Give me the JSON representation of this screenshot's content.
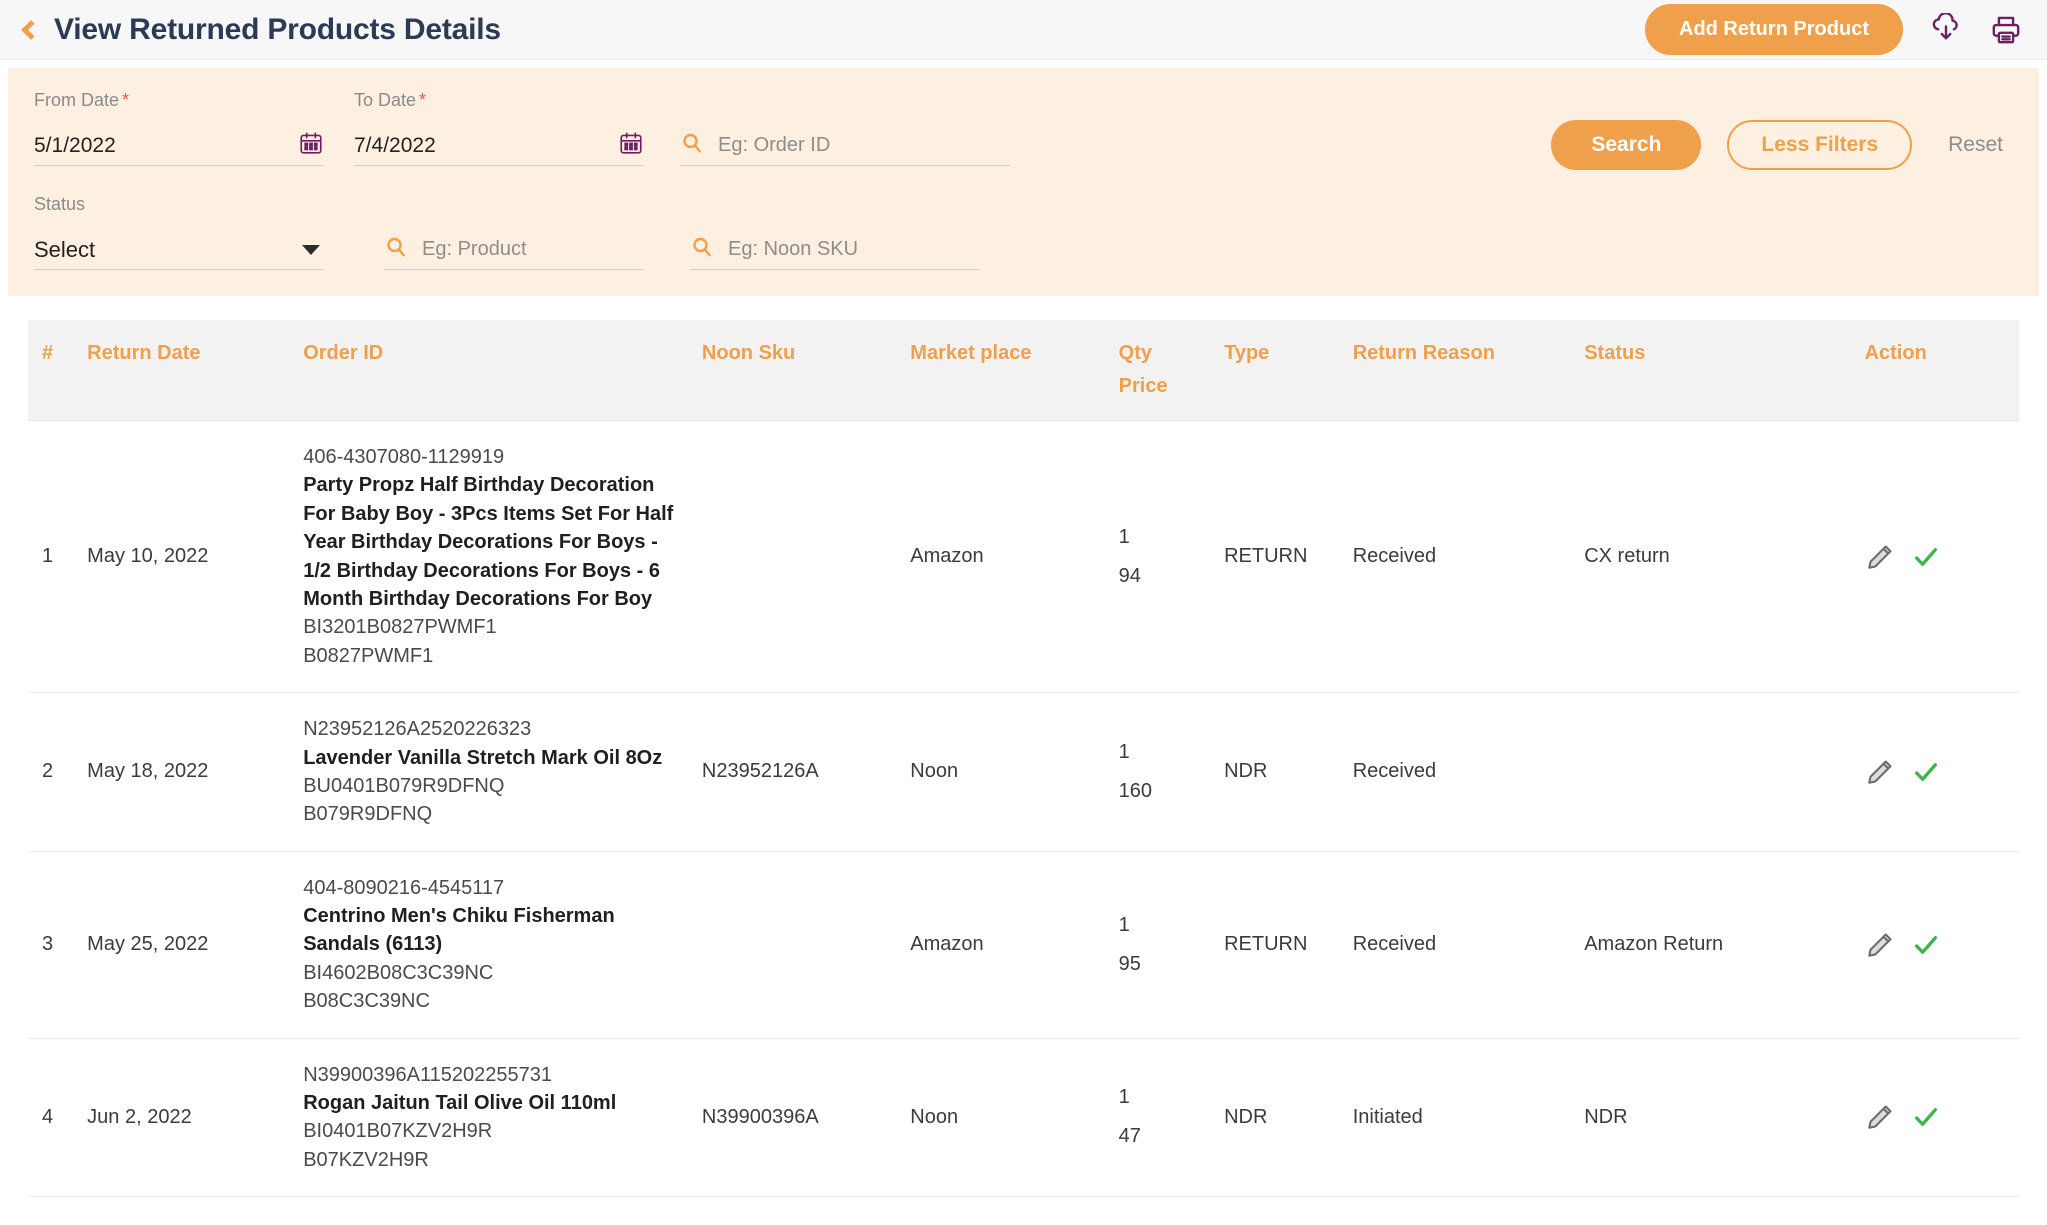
{
  "header": {
    "title": "View Returned Products Details",
    "back_icon": "chevron-left-icon",
    "add_button": "Add Return Product",
    "download_icon": "download-icon",
    "print_icon": "print-icon",
    "accent_color": "#f0a04b",
    "icon_color": "#6d2060"
  },
  "filters": {
    "from_date": {
      "label": "From Date",
      "required": "*",
      "value": "5/1/2022",
      "icon": "calendar-icon"
    },
    "to_date": {
      "label": "To Date",
      "required": "*",
      "value": "7/4/2022",
      "icon": "calendar-icon"
    },
    "order_id": {
      "placeholder": "Eg: Order ID",
      "value": "",
      "icon": "search-icon"
    },
    "status": {
      "label": "Status",
      "value": "Select",
      "icon": "chevron-down-icon"
    },
    "product": {
      "placeholder": "Eg: Product",
      "value": "",
      "icon": "search-icon"
    },
    "noon_sku": {
      "placeholder": "Eg: Noon SKU",
      "value": "",
      "icon": "search-icon"
    },
    "search_button": "Search",
    "less_filters_button": "Less Filters",
    "reset_button": "Reset",
    "panel_color": "#fdf0e0"
  },
  "table": {
    "columns": [
      {
        "key": "num",
        "label": "#"
      },
      {
        "key": "return_date",
        "label": "Return Date"
      },
      {
        "key": "order",
        "label": "Order ID"
      },
      {
        "key": "noon_sku",
        "label": "Noon Sku"
      },
      {
        "key": "market_place",
        "label": "Market place"
      },
      {
        "key": "qty",
        "label": "Qty",
        "sub": "Price"
      },
      {
        "key": "type",
        "label": "Type"
      },
      {
        "key": "return_reason",
        "label": "Return Reason"
      },
      {
        "key": "status",
        "label": "Status"
      },
      {
        "key": "action",
        "label": "Action"
      }
    ],
    "rows": [
      {
        "num": "1",
        "return_date": "May 10, 2022",
        "order_id": "406-4307080-1129919",
        "product_name": "Party Propz Half Birthday Decoration For Baby Boy - 3Pcs Items Set For Half Year Birthday Decorations For Boys - 1/2 Birthday Decorations For Boys - 6 Month Birthday Decorations For Boy",
        "sku1": "BI3201B0827PWMF1",
        "sku2": "B0827PWMF1",
        "noon_sku": "",
        "market_place": "Amazon",
        "qty": "1",
        "price": "94",
        "type": "RETURN",
        "return_reason": "Received",
        "status": "CX return",
        "edit_icon": "edit-pencil-icon",
        "confirm_icon": "check-icon"
      },
      {
        "num": "2",
        "return_date": "May 18, 2022",
        "order_id": "N23952126A2520226323",
        "product_name": "Lavender Vanilla Stretch Mark Oil 8Oz",
        "sku1": "BU0401B079R9DFNQ",
        "sku2": "B079R9DFNQ",
        "noon_sku": "N23952126A",
        "market_place": "Noon",
        "qty": "1",
        "price": "160",
        "type": "NDR",
        "return_reason": "Received",
        "status": "",
        "edit_icon": "edit-pencil-icon",
        "confirm_icon": "check-icon"
      },
      {
        "num": "3",
        "return_date": "May 25, 2022",
        "order_id": "404-8090216-4545117",
        "product_name": "Centrino Men's Chiku Fisherman Sandals (6113)",
        "sku1": "BI4602B08C3C39NC",
        "sku2": "B08C3C39NC",
        "noon_sku": "",
        "market_place": "Amazon",
        "qty": "1",
        "price": "95",
        "type": "RETURN",
        "return_reason": "Received",
        "status": "Amazon Return",
        "edit_icon": "edit-pencil-icon",
        "confirm_icon": "check-icon"
      },
      {
        "num": "4",
        "return_date": "Jun 2, 2022",
        "order_id": "N39900396A115202255731",
        "product_name": "Rogan Jaitun Tail Olive Oil 110ml",
        "sku1": "BI0401B07KZV2H9R",
        "sku2": "B07KZV2H9R",
        "noon_sku": "N39900396A",
        "market_place": "Noon",
        "qty": "1",
        "price": "47",
        "type": "NDR",
        "return_reason": "Initiated",
        "status": "NDR",
        "edit_icon": "edit-pencil-icon",
        "confirm_icon": "check-icon"
      }
    ]
  }
}
